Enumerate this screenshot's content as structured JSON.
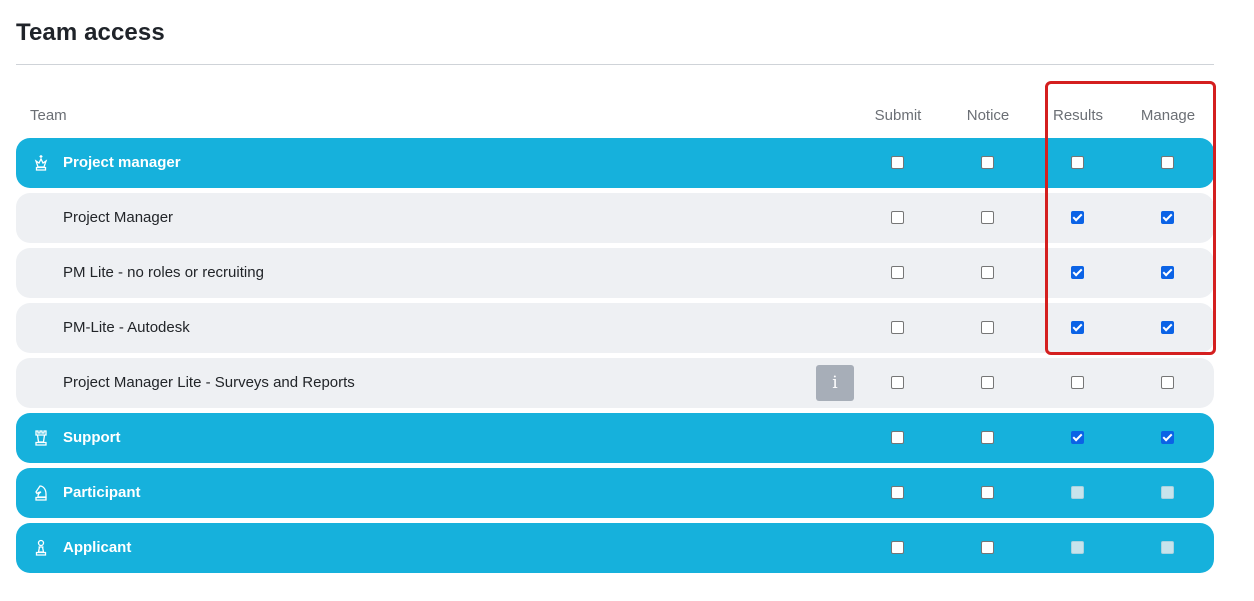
{
  "title": "Team access",
  "headers": {
    "team": "Team",
    "submit": "Submit",
    "notice": "Notice",
    "results": "Results",
    "manage": "Manage"
  },
  "info_glyph": "i",
  "colors": {
    "group_row": "#16b1dc",
    "sub_row": "#eef0f3",
    "checkbox_checked": "#0b63e6",
    "highlight": "#d41f1f"
  },
  "rows": [
    {
      "label": "Project manager",
      "kind": "group",
      "icon": "king-chess-icon",
      "submit": false,
      "notice": false,
      "results": false,
      "manage": false
    },
    {
      "label": "Project Manager",
      "kind": "sub",
      "submit": false,
      "notice": false,
      "results": true,
      "manage": true
    },
    {
      "label": "PM Lite - no roles or recruiting",
      "kind": "sub",
      "submit": false,
      "notice": false,
      "results": true,
      "manage": true
    },
    {
      "label": "PM-Lite - Autodesk",
      "kind": "sub",
      "submit": false,
      "notice": false,
      "results": true,
      "manage": true
    },
    {
      "label": "Project Manager Lite - Surveys and Reports",
      "kind": "sub",
      "info": true,
      "submit": false,
      "notice": false,
      "results": false,
      "manage": false
    },
    {
      "label": "Support",
      "kind": "group",
      "icon": "rook-chess-icon",
      "submit": false,
      "notice": false,
      "results": true,
      "manage": true
    },
    {
      "label": "Participant",
      "kind": "group",
      "icon": "knight-chess-icon",
      "submit": false,
      "notice": false,
      "results": "disabled",
      "manage": "disabled"
    },
    {
      "label": "Applicant",
      "kind": "group",
      "icon": "pawn-chess-icon",
      "submit": false,
      "notice": false,
      "results": "disabled",
      "manage": "disabled"
    }
  ]
}
